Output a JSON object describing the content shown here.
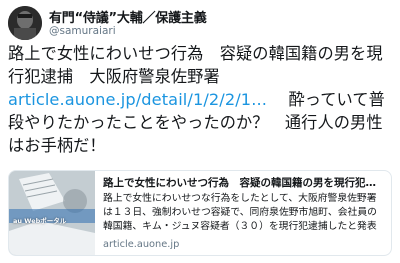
{
  "user": {
    "display_name": "有門“侍議”大輔／保護主義",
    "handle": "@samuraiari"
  },
  "tweet": {
    "text_before_link": "路上で女性にわいせつ行為　容疑の韓国籍の男を現行犯逮捕　大阪府警泉佐野署 ",
    "link_text": "article.auone.jp/detail/1/2/2/1...",
    "text_after_link": " 　酔っていて普段やりたかったことをやったのか？　通行人の男性はお手柄だ！"
  },
  "card": {
    "title": "路上で女性にわいせつ行為　容疑の韓国籍の男を現行犯逮捕…",
    "description": "路上で女性にわいせつな行為をしたとして、大阪府警泉佐野署は１３日、強制わいせつ容疑で、同府泉佐野市旭町、会社員の韓国籍、キム・ジュヌ容疑者（３０）を現行犯逮捕したと発表した。 逮捕容...",
    "domain": "article.auone.jp",
    "thumbnail_label": "au Webポータル"
  },
  "colors": {
    "link": "#1b95e0",
    "secondary_text": "#657786",
    "card_border": "#e1e8ed"
  }
}
